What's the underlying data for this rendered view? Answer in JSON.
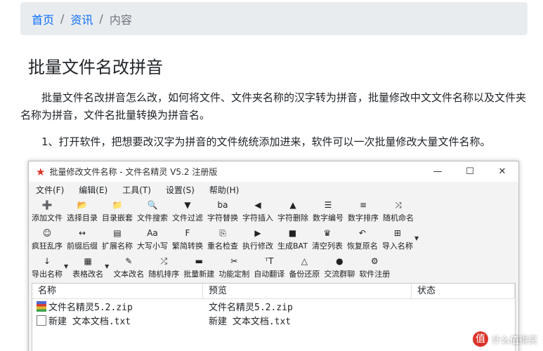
{
  "breadcrumb": {
    "items": [
      "首页",
      "资讯"
    ],
    "current": "内容",
    "separator": "/"
  },
  "article": {
    "title": "批量文件名改拼音",
    "para1": "批量文件名改拼音怎么改，如何将文件、文件夹名称的汉字转为拼音，批量修改中文文件名称以及文件夹名称为拼音，文件名批量转换为拼音名。",
    "para2": "1、打开软件，把想要改汉字为拼音的文件统统添加进来，软件可以一次批量修改大量文件名称。"
  },
  "app": {
    "title": "批量修改文件名称 - 文件名精灵 V5.2 注册版",
    "window_buttons": [
      "—",
      "☐",
      "✕"
    ],
    "menu": [
      "文件(F)",
      "编辑(E)",
      "工具(T)",
      "设置(S)",
      "帮助(H)"
    ],
    "toolbar_rows": [
      [
        {
          "label": "添加文件",
          "icon": "➕",
          "name": "add-file"
        },
        {
          "label": "选择目录",
          "icon": "📂",
          "name": "select-folder"
        },
        {
          "label": "目录嵌套",
          "icon": "📁",
          "name": "folder-nesting"
        },
        {
          "label": "文件搜索",
          "icon": "🔍",
          "name": "file-search"
        },
        {
          "label": "文件过滤",
          "icon": "▼",
          "name": "file-filter"
        },
        {
          "label": "字符替换",
          "icon": "ba",
          "name": "char-replace"
        },
        {
          "label": "字符插入",
          "icon": "◀",
          "name": "char-insert"
        },
        {
          "label": "字符删除",
          "icon": "▲",
          "name": "char-delete"
        },
        {
          "label": "数字编号",
          "icon": "☰",
          "name": "number-code"
        },
        {
          "label": "数字排序",
          "icon": "≡",
          "name": "number-sort"
        },
        {
          "label": "随机命名",
          "icon": "⤨",
          "name": "random-name"
        }
      ],
      [
        {
          "label": "疯狂乱序",
          "icon": "☺",
          "name": "crazy-shuffle"
        },
        {
          "label": "前缀后缀",
          "icon": "↔",
          "name": "prefix-suffix"
        },
        {
          "label": "扩展名称",
          "icon": "▤",
          "name": "extension-name"
        },
        {
          "label": "大写小写",
          "icon": "Aa",
          "name": "upper-lower"
        },
        {
          "label": "繁简转换",
          "icon": "F",
          "name": "trad-simp"
        },
        {
          "label": "重名检查",
          "icon": "⎘",
          "name": "duplicate-check"
        },
        {
          "label": "执行修改",
          "icon": "▶",
          "name": "execute"
        },
        {
          "label": "生成BAT",
          "icon": "■",
          "name": "generate-bat"
        },
        {
          "label": "清空列表",
          "icon": "♛",
          "name": "clear-list"
        },
        {
          "label": "恢复原名",
          "icon": "↶",
          "name": "restore-name"
        },
        {
          "label": "导入名称",
          "icon": "⊞",
          "name": "import-names",
          "dropdown": true
        }
      ],
      [
        {
          "label": "导出名称",
          "icon": "↓",
          "name": "export-names",
          "dropdown": true
        },
        {
          "label": "表格改名",
          "icon": "▦",
          "name": "table-rename",
          "dropdown": true
        },
        {
          "label": "文本改名",
          "icon": "✎",
          "name": "text-rename"
        },
        {
          "label": "随机排序",
          "icon": "⤮",
          "name": "random-sort"
        },
        {
          "label": "批量新建",
          "icon": "▬",
          "name": "batch-create"
        },
        {
          "label": "功能定制",
          "icon": "✂",
          "name": "customize"
        },
        {
          "label": "自动翻译",
          "icon": "ᵀT",
          "name": "auto-translate"
        },
        {
          "label": "备份还原",
          "icon": "△",
          "name": "backup-restore"
        },
        {
          "label": "交流群聊",
          "icon": "●",
          "name": "group-chat"
        },
        {
          "label": "软件注册",
          "icon": "⚙",
          "name": "register"
        }
      ]
    ],
    "file_list": {
      "columns": [
        "名称",
        "预览",
        "状态"
      ],
      "rows": [
        {
          "name": "文件名精灵5.2.zip",
          "preview": "文件名精灵5.2.zip",
          "status": "",
          "icon": "zip"
        },
        {
          "name": "新建 文本文档.txt",
          "preview": "新建 文本文档.txt",
          "status": "",
          "icon": "txt"
        }
      ]
    }
  },
  "watermark": {
    "logo": "值",
    "text": "什么值得买"
  }
}
